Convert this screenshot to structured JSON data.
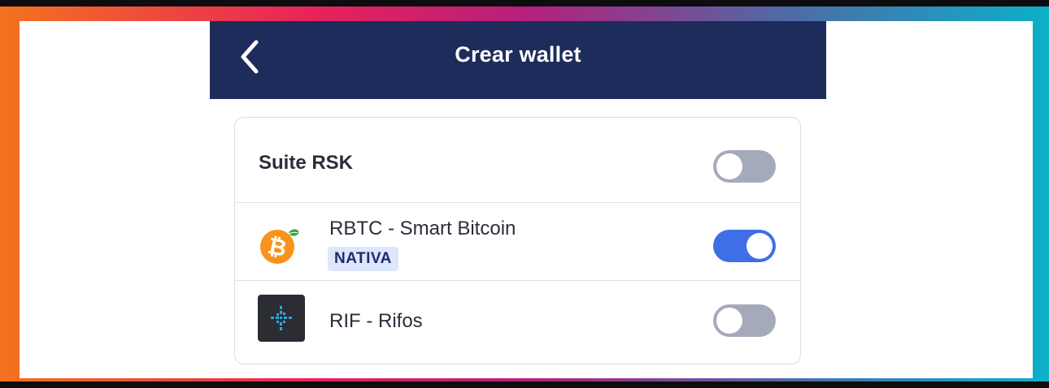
{
  "header": {
    "title": "Crear wallet",
    "back_icon": "chevron-left-icon"
  },
  "suite": {
    "label": "Suite RSK",
    "enabled": false
  },
  "tokens": [
    {
      "name": "RBTC - Smart Bitcoin",
      "badge": "NATIVA",
      "icon": "rbtc-bitcoin-icon",
      "enabled": true
    },
    {
      "name": "RIF - Rifos",
      "icon": "rif-logo-icon",
      "enabled": false
    }
  ],
  "colors": {
    "header_bg": "#1e2c5c",
    "toggle_on": "#3f6fe6",
    "toggle_off": "#a5aabb",
    "badge_bg": "#dde6fb",
    "badge_text": "#1e2c6a"
  }
}
